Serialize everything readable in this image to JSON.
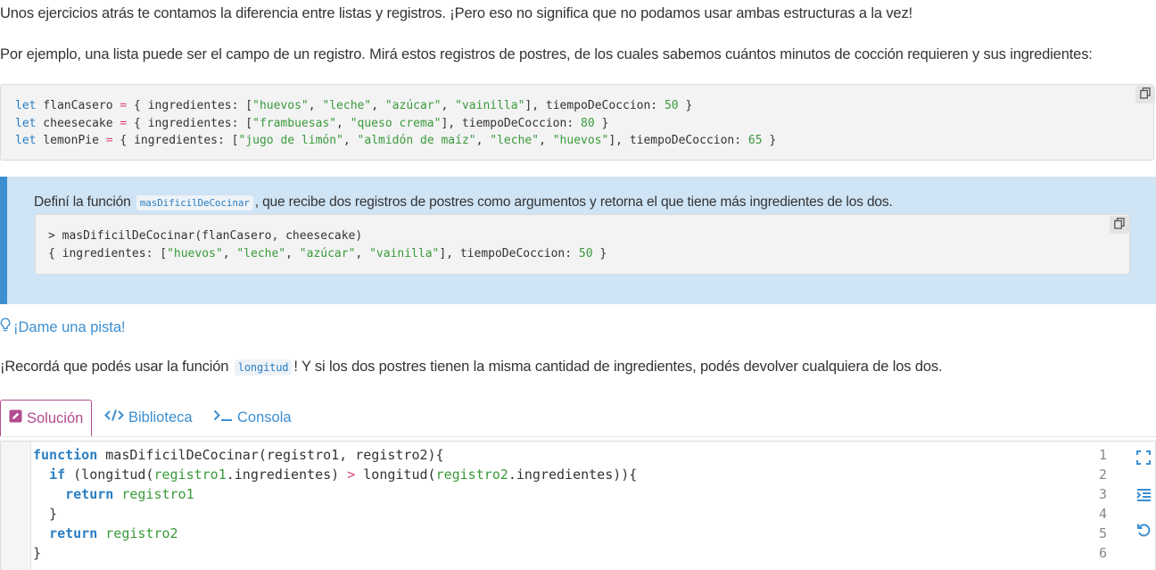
{
  "intro": {
    "p1": "Unos ejercicios atrás te contamos la diferencia entre listas y registros. ¡Pero eso no significa que no podamos usar ambas estructuras a la vez!",
    "p2": "Por ejemplo, una lista puede ser el campo de un registro. Mirá estos registros de postres, de los cuales sabemos cuántos minutos de cocción requieren y sus ingredientes:"
  },
  "example_code": {
    "copy_icon": "copy-icon",
    "lines": [
      "let flanCasero = { ingredientes: [\"huevos\", \"leche\", \"azúcar\", \"vainilla\"], tiempoDeCoccion: 50 }",
      "let cheesecake = { ingredientes: [\"frambuesas\", \"queso crema\"], tiempoDeCoccion: 80 }",
      "let lemonPie = { ingredientes: [\"jugo de limón\", \"almidón de maíz\", \"leche\", \"huevos\"], tiempoDeCoccion: 65 }"
    ]
  },
  "task": {
    "before": "Definí la función",
    "function_name": "masDificilDeCocinar",
    "after": ", que recibe dos registros de postres como argumentos y retorna el que tiene más ingredientes de los dos.",
    "console_lines": [
      "> masDificilDeCocinar(flanCasero, cheesecake)",
      "{ ingredientes: [\"huevos\", \"leche\", \"azúcar\", \"vainilla\"], tiempoDeCoccion: 50 }"
    ]
  },
  "hint": {
    "link_label": "¡Dame una pista!",
    "before": "¡Recordá que podés usar la función",
    "function_name": "longitud",
    "after": "! Y si los dos postres tienen la misma cantidad de ingredientes, podés devolver cualquiera de los dos."
  },
  "tabs": [
    {
      "label": "Solución",
      "icon": "edit-icon",
      "active": true
    },
    {
      "label": "Biblioteca",
      "icon": "code-icon",
      "active": false
    },
    {
      "label": "Consola",
      "icon": "terminal-icon",
      "active": false
    }
  ],
  "editor": {
    "line_numbers": [
      "1",
      "2",
      "3",
      "4",
      "5",
      "6"
    ],
    "lines": [
      "function masDificilDeCocinar(registro1, registro2){",
      "  if (longitud(registro1.ingredientes) > longitud(registro2.ingredientes)){",
      "    return registro1",
      "  }",
      "  return registro2",
      "}"
    ],
    "side_icons": [
      "fullscreen-icon",
      "indent-icon",
      "reset-icon"
    ]
  },
  "colors": {
    "accent": "#3c8fd1",
    "active_tab": "#b34b8f",
    "task_bg": "#cfe4f5",
    "string": "#3a9a3a",
    "keyword": "#2a7ec2",
    "operator": "#e0457b"
  }
}
